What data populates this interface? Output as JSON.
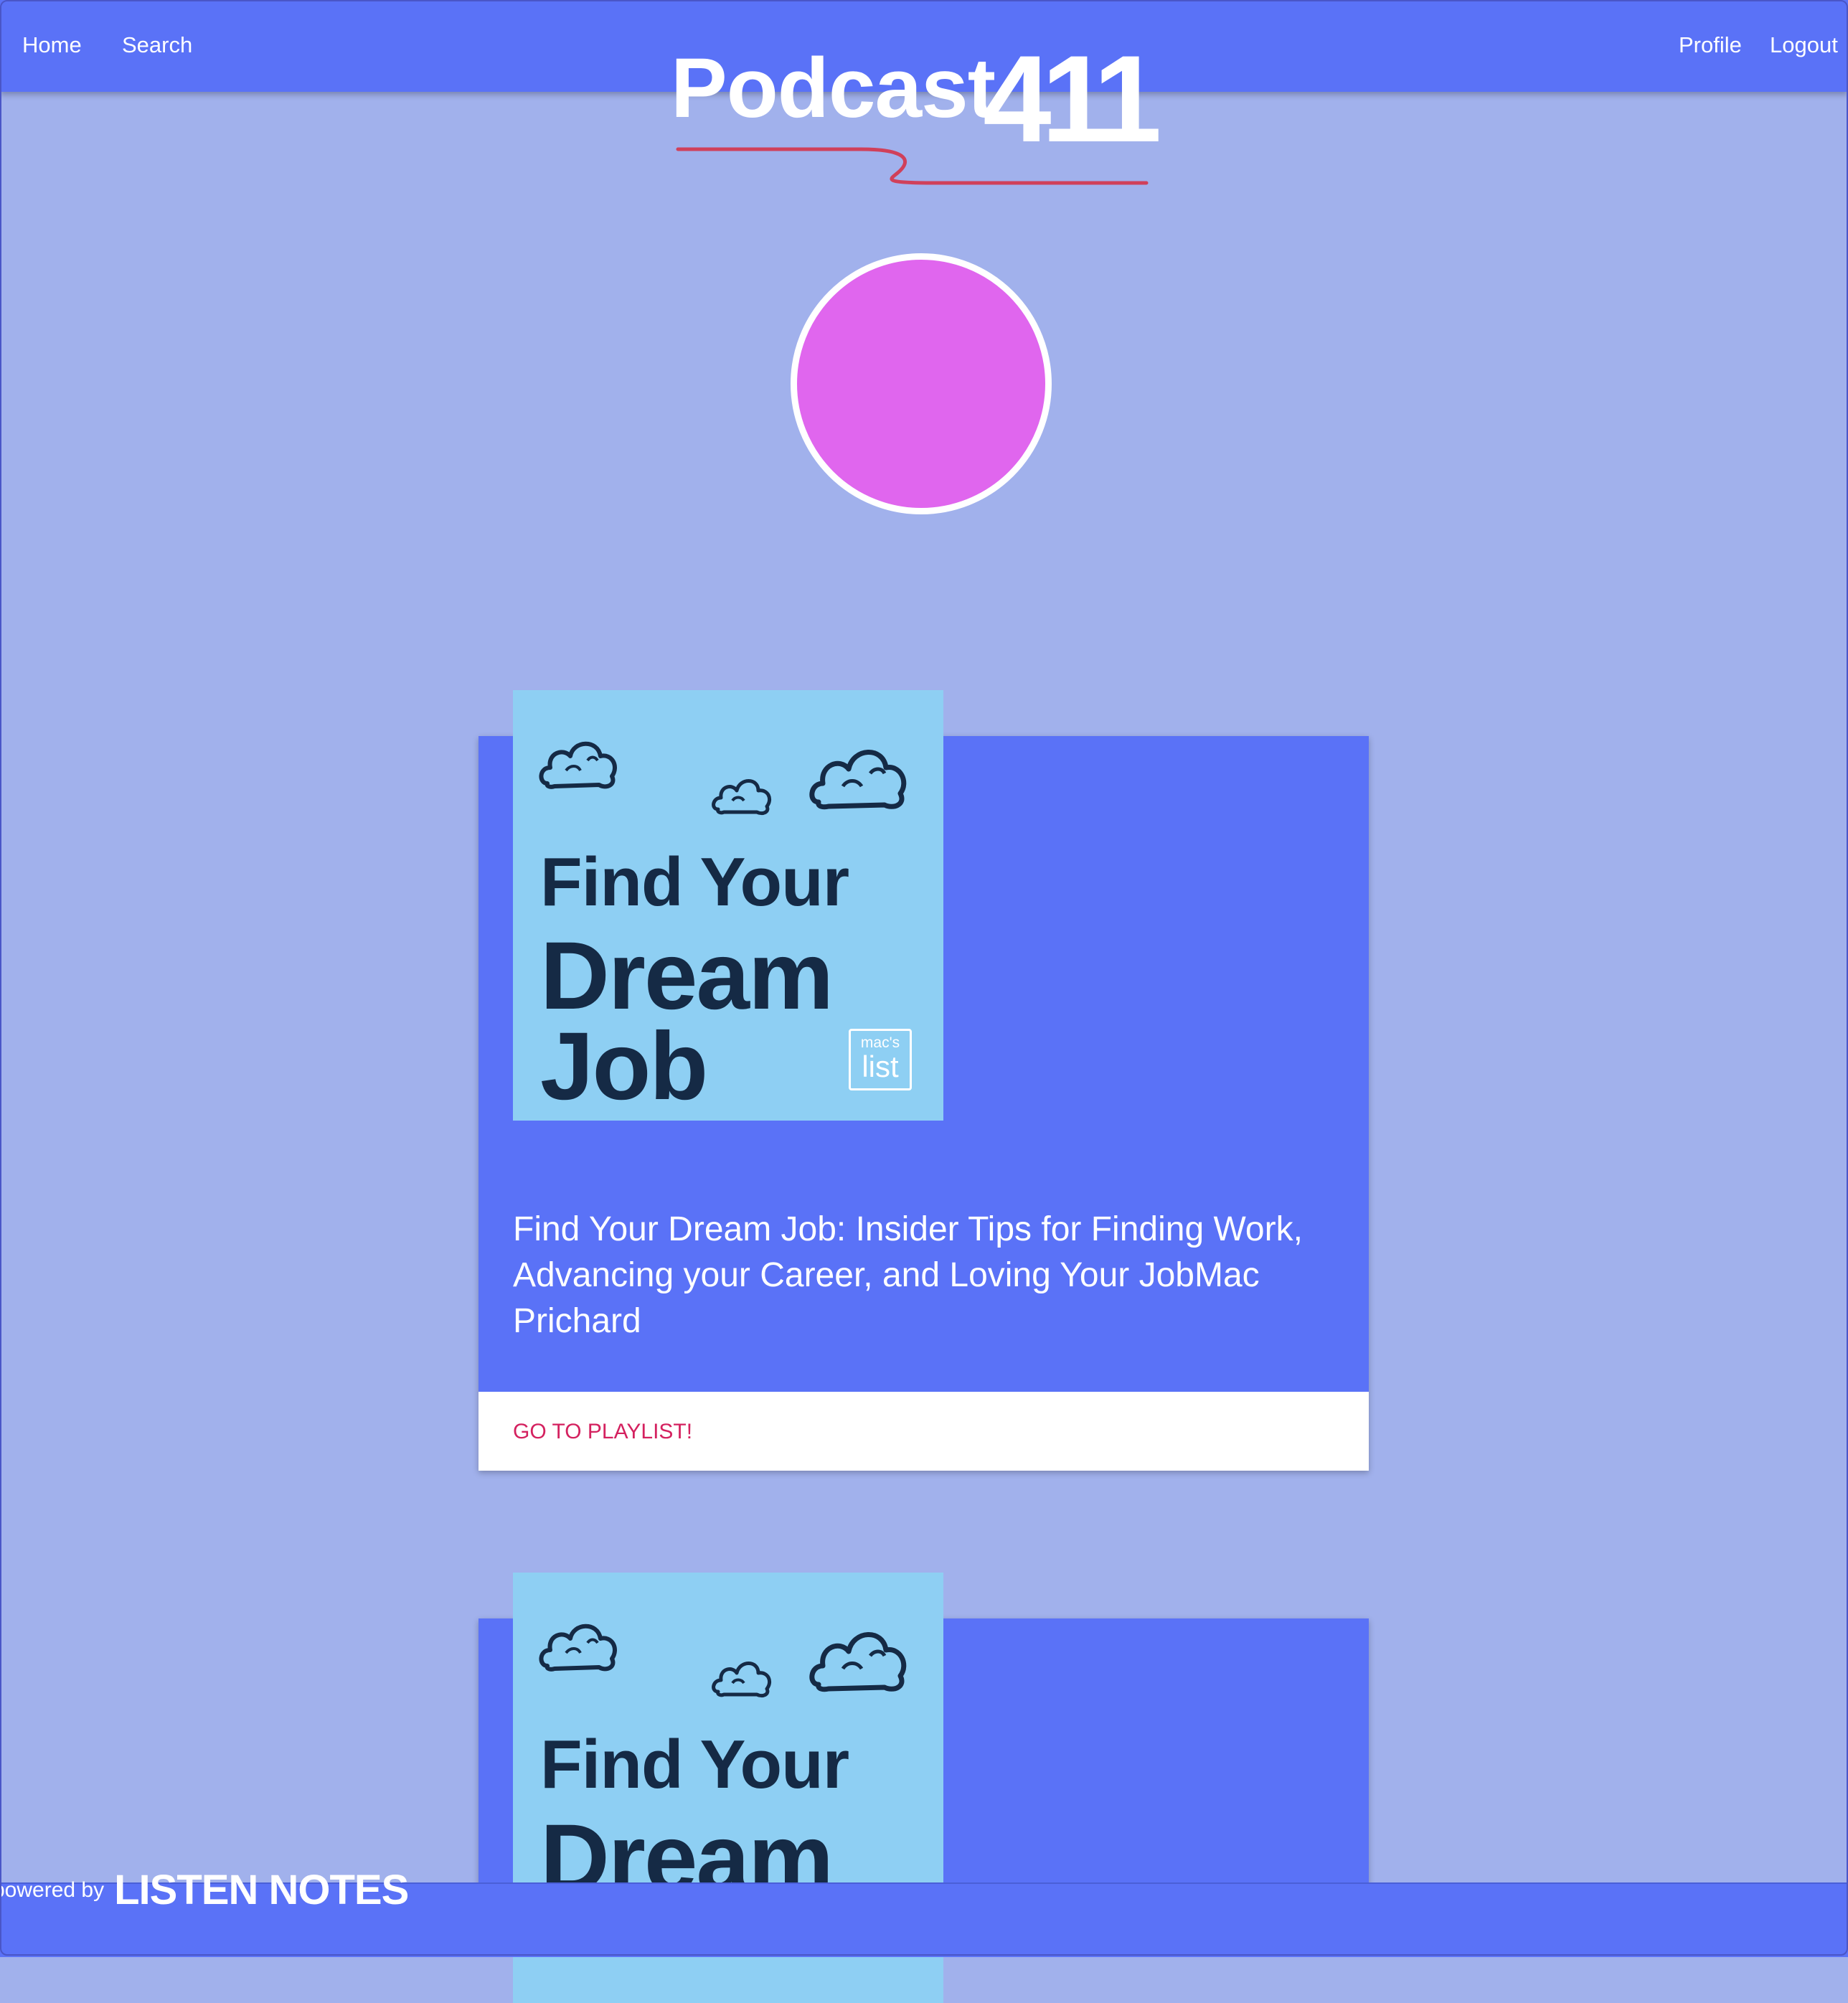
{
  "nav": {
    "left_links": [
      "Home",
      "Search"
    ],
    "right_links": [
      "Profile",
      "Logout"
    ]
  },
  "logo": {
    "word": "Podcast",
    "number": "411",
    "underline_color": "#d0405a"
  },
  "avatar": {
    "color": "#e066ee"
  },
  "cards": [
    {
      "cover": {
        "line1": "Find Your",
        "line2": "Dream",
        "line3": "Job",
        "badge_top": "mac's",
        "badge_bottom": "list"
      },
      "description": "Find Your Dream Job: Insider Tips for Finding Work, Advancing your Career, and Loving Your JobMac Prichard",
      "action": "GO TO PLAYLIST!"
    },
    {
      "cover": {
        "line1": "Find Your",
        "line2": "Dream"
      }
    }
  ],
  "footer": {
    "powered_by": "powered by",
    "brand": "LISTEN NOTES"
  },
  "colors": {
    "page_bg": "#a1b1ec",
    "navbar": "#5a72f7",
    "card": "#5a72f7",
    "cover": "#8ecff3",
    "cover_text": "#152a45",
    "action_link": "#d4215f"
  }
}
